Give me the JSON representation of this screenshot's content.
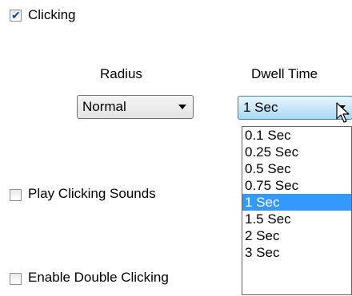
{
  "clicking": {
    "label": "Clicking",
    "checked": true
  },
  "radius": {
    "heading": "Radius",
    "value": "Normal"
  },
  "dwell_time": {
    "heading": "Dwell Time",
    "value": "1 Sec",
    "options": [
      "0.1 Sec",
      "0.25 Sec",
      "0.5 Sec",
      "0.75 Sec",
      "1 Sec",
      "1.5 Sec",
      "2 Sec",
      "3 Sec"
    ],
    "selected_index": 4
  },
  "play_sounds": {
    "label": "Play Clicking Sounds",
    "checked": false
  },
  "double_click": {
    "label": "Enable Double Clicking",
    "checked": false
  },
  "colors": {
    "selection": "#3399ff",
    "combo_active_border": "#3c7fb1"
  },
  "icons": {
    "cursor": "arrow-cursor-icon"
  }
}
